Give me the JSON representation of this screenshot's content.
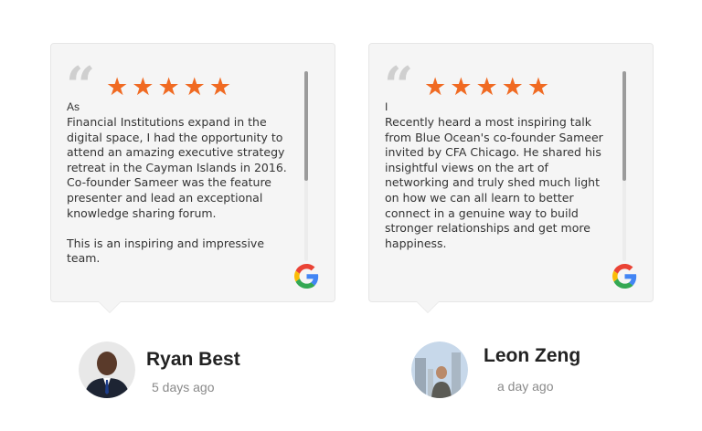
{
  "reviews": [
    {
      "stars": "★★★★★",
      "snippet": "As",
      "text": "Financial Institutions expand in the digital space, I had the opportunity to attend an amazing executive strategy retreat in the Cayman Islands in 2016. Co-founder Sameer was the feature presenter and lead an exceptional knowledge sharing forum.\n\nThis is an inspiring and impressive team.",
      "source_icon": "google-g-icon",
      "reviewer_name": "Ryan Best",
      "time": "5 days ago"
    },
    {
      "stars": "★★★★★",
      "snippet": "I",
      "text": "Recently heard a most inspiring talk from Blue Ocean's co-founder Sameer invited by CFA Chicago.  He shared his insightful views on the art of networking and truly shed much light on how we can all learn to better connect in a genuine way to build stronger relationships and get more happiness.",
      "source_icon": "google-g-icon",
      "reviewer_name": "Leon Zeng",
      "time": "a day ago"
    }
  ],
  "colors": {
    "star": "#f06a22",
    "card_bg": "#f5f5f5",
    "quote": "#cfcfcf"
  }
}
